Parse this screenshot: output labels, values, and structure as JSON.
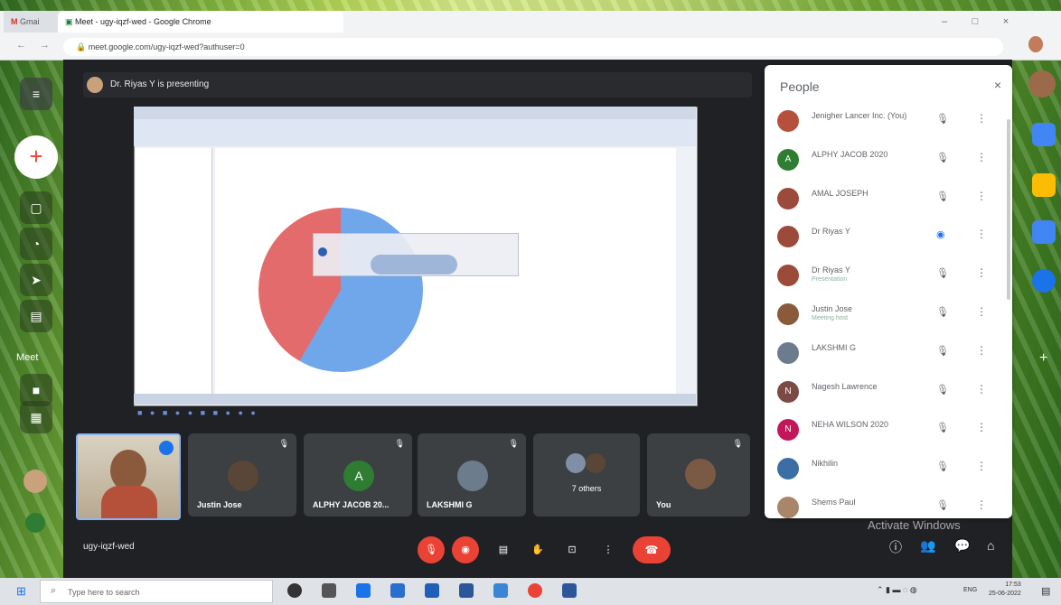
{
  "browser": {
    "tab_gmail": "Gmai",
    "tab_meet": "Meet - ugy-iqzf-wed - Google Chrome",
    "url": "meet.google.com/ugy-iqzf-wed?authuser=0",
    "minimize": "–",
    "maximize": "□",
    "close": "×"
  },
  "meet": {
    "presenting_banner": "Dr. Riyas Y is presenting",
    "meeting_code": "ugy-iqzf-wed",
    "watermark": "Activate Windows"
  },
  "tiles": [
    {
      "name": "",
      "avatar": "self-video"
    },
    {
      "name": "Justin Jose",
      "avatar_letter": ""
    },
    {
      "name": "ALPHY JACOB 20...",
      "avatar_letter": "A"
    },
    {
      "name": "LAKSHMI G",
      "avatar_letter": ""
    },
    {
      "name": "7 others",
      "avatar_letter": ""
    },
    {
      "name": "You",
      "avatar_letter": ""
    }
  ],
  "people_panel": {
    "title": "People",
    "close": "×",
    "participants": [
      {
        "name": "Jenigher Lancer Inc. (You)",
        "sub": "",
        "letter": "",
        "color": "#b5503a"
      },
      {
        "name": "ALPHY JACOB 2020",
        "sub": "",
        "letter": "A",
        "color": "#2e7d32"
      },
      {
        "name": "AMAL JOSEPH",
        "sub": "",
        "letter": "",
        "color": "#9c4a3a"
      },
      {
        "name": "Dr Riyas Y",
        "sub": "",
        "letter": "",
        "color": "#9c4a3a"
      },
      {
        "name": "Dr Riyas Y",
        "sub": "Presentation",
        "letter": "",
        "color": "#9c4a3a"
      },
      {
        "name": "Justin Jose",
        "sub": "Meeting host",
        "letter": "",
        "color": "#8a5a3a"
      },
      {
        "name": "LAKSHMI G",
        "sub": "",
        "letter": "",
        "color": "#6d7c8c"
      },
      {
        "name": "Nagesh Lawrence",
        "sub": "",
        "letter": "N",
        "color": "#7b4a43"
      },
      {
        "name": "NEHA WILSON 2020",
        "sub": "",
        "letter": "N",
        "color": "#c2185b"
      },
      {
        "name": "Nikhilin",
        "sub": "",
        "letter": "",
        "color": "#3b6ea5"
      },
      {
        "name": "Shems Paul",
        "sub": "",
        "letter": "",
        "color": "#a9856a"
      }
    ]
  },
  "dock": {
    "menu": "≡",
    "new": "+",
    "meet_label": "Meet"
  },
  "taskbar": {
    "search_placeholder": "Type here to search",
    "lang": "ENG",
    "time": "17:53",
    "date": "25-06-2022"
  },
  "colors": {
    "accent": "#1a73e8",
    "end_call": "#ea4335",
    "meet_bg": "#202124",
    "pie_blue": "#6fa7ea",
    "pie_red": "#e36b6b"
  }
}
